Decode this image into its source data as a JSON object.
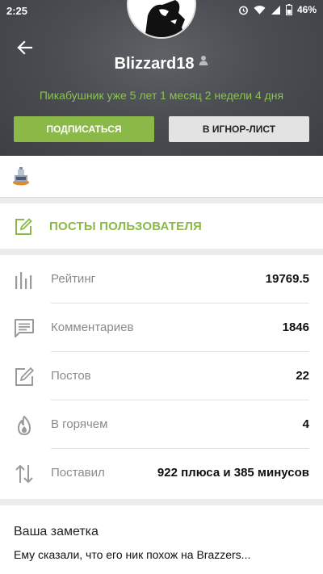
{
  "status_bar": {
    "time": "2:25",
    "battery": "46%",
    "icons": [
      "alarm-icon",
      "wifi-icon",
      "signal-icon",
      "battery-icon"
    ]
  },
  "profile": {
    "username": "Blizzard18",
    "tenure": "Пикабушник уже 5 лет 1 месяц 2 недели 4 дня",
    "subscribe_label": "ПОДПИСАТЬСЯ",
    "ignore_label": "В ИГНОР-ЛИСТ"
  },
  "posts_link": {
    "label": "ПОСТЫ ПОЛЬЗОВАТЕЛЯ"
  },
  "stats": [
    {
      "icon": "rating-bars-icon",
      "label": "Рейтинг",
      "value": "19769.5"
    },
    {
      "icon": "comment-icon",
      "label": "Комментариев",
      "value": "1846"
    },
    {
      "icon": "edit-post-icon",
      "label": "Постов",
      "value": "22"
    },
    {
      "icon": "flame-icon",
      "label": "В горячем",
      "value": "4"
    },
    {
      "icon": "up-down-arrows-icon",
      "label": "Поставил",
      "value": "922 плюса и 385 минусов"
    }
  ],
  "note": {
    "title": "Ваша заметка",
    "text": "Ему сказали, что его ник похож на Brazzers..."
  },
  "colors": {
    "accent_green": "#8ab948",
    "tenure_green": "#8cc152",
    "header_bg": "#4a4d52"
  }
}
